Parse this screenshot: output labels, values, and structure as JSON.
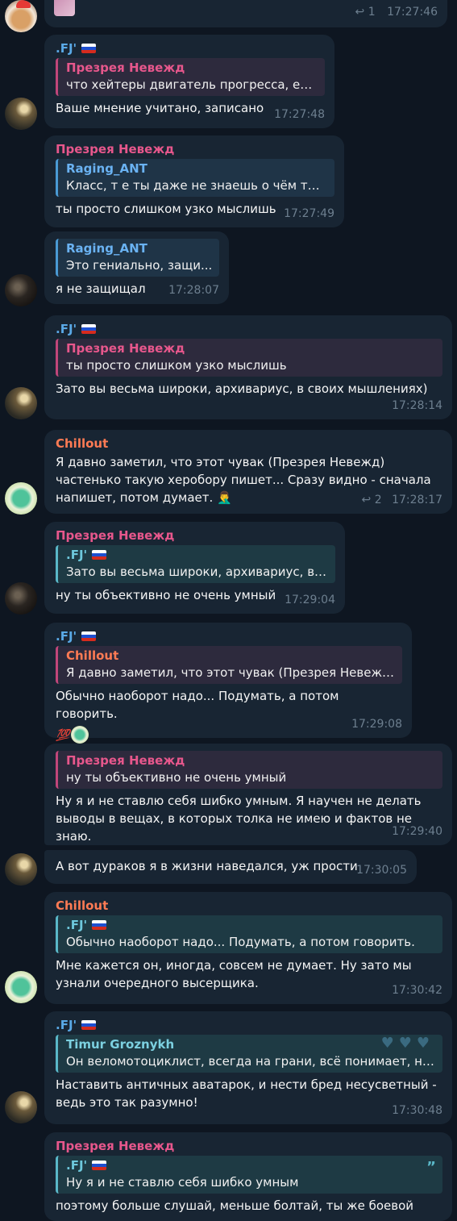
{
  "messages": [
    {
      "fwd_icon": "↩",
      "fwd_count": "1",
      "time": "17:27:46"
    },
    {
      "sender": ".FJ'",
      "reply_name": "Презрея Невежд",
      "reply_text": "что хейтеры двигатель прогресса, ещ...",
      "text": "Ваше мнение учитано, записано",
      "time": "17:27:48"
    },
    {
      "sender": "Презрея Невежд",
      "reply_name": "Raging_ANT",
      "reply_text": "Класс, т е ты даже не знаешь о чём ты п...",
      "text": "ты просто слишком узко мыслишь",
      "time": "17:27:49"
    },
    {
      "reply_name": "Raging_ANT",
      "reply_text": "Это гениально, защи...",
      "text": "я не защищал",
      "time": "17:28:07"
    },
    {
      "sender": ".FJ'",
      "reply_name": "Презрея Невежд",
      "reply_text": "ты просто слишком узко мыслишь",
      "text": "Зато вы весьма широки, архивариус, в своих мышлениях)",
      "time": "17:28:14"
    },
    {
      "sender": "Chillout",
      "text": "Я давно заметил, что этот чувак (Презрея Невежд) частенько такую херобору пишет... Сразу видно - сначала напишет, потом думает. 🤦‍♂️",
      "fwd_icon": "↩",
      "fwd_count": "2",
      "time": "17:28:17"
    },
    {
      "sender": "Презрея Невежд",
      "reply_name": ".FJ'",
      "reply_text": "Зато вы весьма широки, архивариус, в ...",
      "text": "ну ты объективно не очень умный",
      "time": "17:29:04"
    },
    {
      "sender": ".FJ'",
      "reply_name": "Chillout",
      "reply_text": "Я давно заметил, что этот чувак (Презрея Невежд)...",
      "text": "Обычно наоборот надо... Подумать, а потом говорить.",
      "reaction": "💯",
      "time": "17:29:08"
    },
    {
      "reply_name": "Презрея Невежд",
      "reply_text": "ну ты объективно не очень умный",
      "text": "Ну я и не ставлю себя шибко умным. Я научен не делать выводы в вещах, в которых толка не имею и фактов не знаю.",
      "time": "17:29:40"
    },
    {
      "text": "А вот дураков я в жизни наведался, уж прости",
      "time": "17:30:05"
    },
    {
      "sender": "Chillout",
      "reply_name": ".FJ'",
      "reply_text": "Обычно наоборот надо... Подумать, а потом говорить.",
      "text": "Мне кажется он, иногда, совсем не думает. Ну зато мы узнали очередного высерщика.",
      "time": "17:30:42"
    },
    {
      "sender": ".FJ'",
      "reply_name": "Timur Groznykh",
      "reply_text": "Он веломотоциклист, всегда на грани, всё понимает, не ...",
      "text": "Наставить античных аватарок, и нести бред несусветный - ведь это так разумно!",
      "time": "17:30:48"
    },
    {
      "sender": "Презрея Невежд",
      "reply_name": ".FJ'",
      "reply_text": "Ну я и не ставлю себя шибко умным",
      "text": "поэтому больше слушай, меньше болтай, ты же боевой"
    }
  ],
  "colors": {
    "background": "#0e1621",
    "bubble": "#182533",
    "name_blue": "#5aa9e6",
    "name_pink": "#e7578c",
    "name_orange": "#ff7b54",
    "time": "#6d7f8f"
  }
}
